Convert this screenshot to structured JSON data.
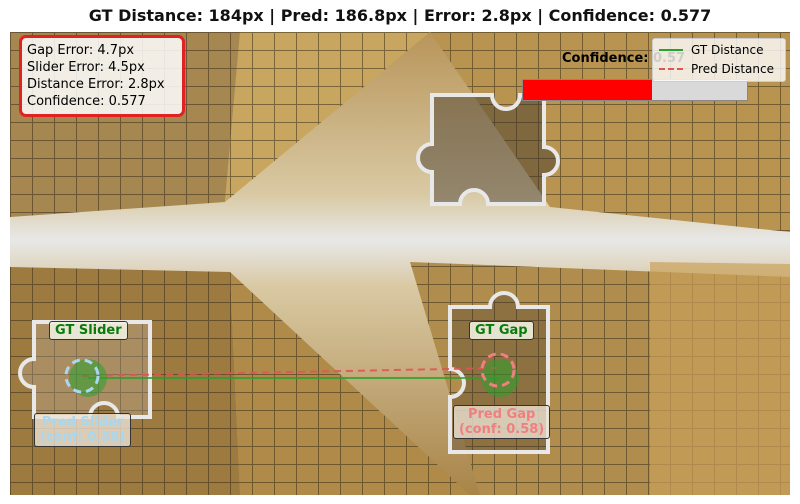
{
  "title": "GT Distance: 184px | Pred: 186.8px | Error: 2.8px | Confidence: 0.577",
  "metrics": {
    "gap_error": "Gap Error: 4.7px",
    "slider_error": "Slider Error: 4.5px",
    "distance_error": "Distance Error: 2.8px",
    "confidence": "Confidence: 0.577"
  },
  "confidence_bar": {
    "label": "Confidence: 0.57",
    "value": 0.577,
    "fill_color": "#ff0000"
  },
  "legend": {
    "gt_label": "GT Distance",
    "pred_label": "Pred Distance",
    "gt_color": "#2ca02c",
    "pred_color": "#e05555"
  },
  "annotations": {
    "gt_slider": "GT Slider",
    "gt_gap": "GT Gap",
    "pred_slider_line1": "Pred Slider",
    "pred_slider_line2": "(conf: 0.58)",
    "pred_gap_line1": "Pred Gap",
    "pred_gap_line2": "(conf: 0.58)"
  },
  "colors": {
    "gt_green": "#0a7a0a",
    "pred_slider_blue": "#a8d8f0",
    "pred_gap_red": "#f08080",
    "metrics_border": "#e02222"
  }
}
